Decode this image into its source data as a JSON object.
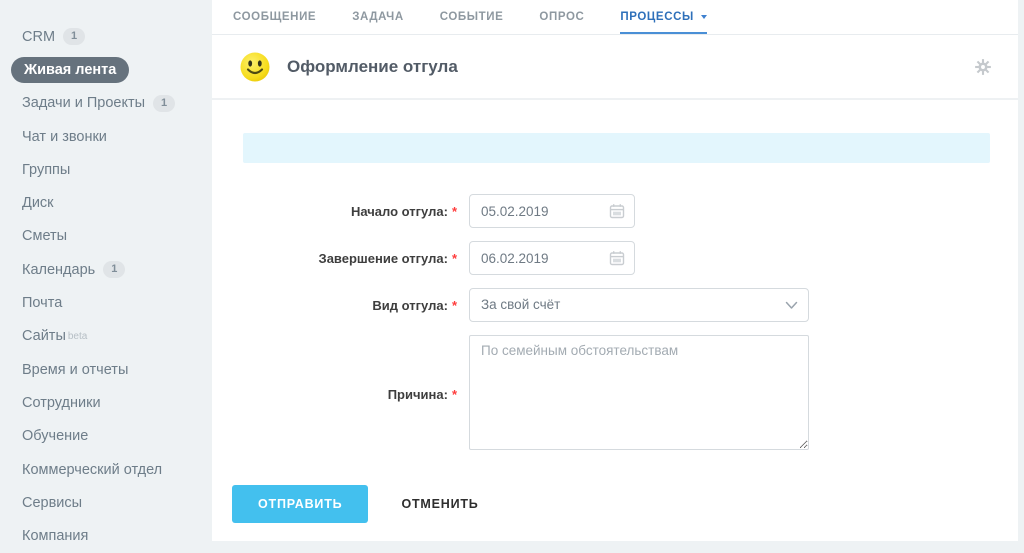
{
  "sidebar": {
    "items": [
      {
        "label": "CRM",
        "badge": "1"
      },
      {
        "label": "Живая лента",
        "selected": true
      },
      {
        "label": "Задачи и Проекты",
        "badge": "1"
      },
      {
        "label": "Чат и звонки"
      },
      {
        "label": "Группы"
      },
      {
        "label": "Диск"
      },
      {
        "label": "Сметы"
      },
      {
        "label": "Календарь",
        "badge": "1"
      },
      {
        "label": "Почта"
      },
      {
        "label": "Сайты",
        "suffix": "beta"
      },
      {
        "label": "Время и отчеты"
      },
      {
        "label": "Сотрудники"
      },
      {
        "label": "Обучение"
      },
      {
        "label": "Коммерческий отдел"
      },
      {
        "label": "Сервисы"
      },
      {
        "label": "Компания"
      }
    ]
  },
  "tabs": {
    "items": [
      {
        "label": "СООБЩЕНИЕ",
        "active": false
      },
      {
        "label": "ЗАДАЧА",
        "active": false
      },
      {
        "label": "СОБЫТИЕ",
        "active": false
      },
      {
        "label": "ОПРОС",
        "active": false
      },
      {
        "label": "ПРОЦЕССЫ",
        "active": true,
        "has_dropdown": true
      }
    ]
  },
  "header": {
    "title": "Оформление отгула",
    "icon": "smiley-icon",
    "settings_icon": "gear-icon"
  },
  "form": {
    "required_mark": "*",
    "fields": {
      "start_date": {
        "label": "Начало отгула:",
        "value": "05.02.2019",
        "icon": "calendar-icon"
      },
      "end_date": {
        "label": "Завершение отгула:",
        "value": "06.02.2019",
        "icon": "calendar-icon"
      },
      "leave_type": {
        "label": "Вид отгула:",
        "value": "За свой счёт",
        "icon": "chevron-down-icon"
      },
      "reason": {
        "label": "Причина:",
        "placeholder": "По семейным обстоятельствам"
      }
    },
    "actions": {
      "submit": "ОТПРАВИТЬ",
      "cancel": "ОТМЕНИТЬ"
    }
  },
  "colors": {
    "accent_blue": "#2e70ba",
    "tab_underline": "#4a8fd6",
    "submit_button": "#43c0ee",
    "selected_pill": "#66727d",
    "info_strip": "#e3f6fd",
    "required": "#ff3c3c",
    "page_background": "#eef2f4"
  }
}
